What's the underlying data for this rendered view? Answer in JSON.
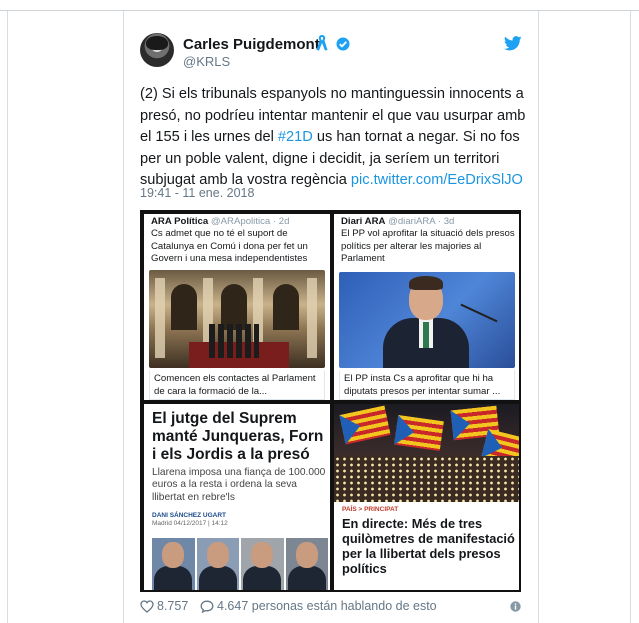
{
  "tweet": {
    "display_name": "Carles Puigdemont",
    "handle": "@KRLS",
    "text_before_hashtag": "(2) Si els tribunals espanyols no mantinguessin innocents a presó, no podríeu intentar mantenir el que  vau usurpar amb el 155 i les urnes del ",
    "hashtag": "#21D",
    "text_after_hashtag": " us han tornat a negar. Si no fos per un poble valent, digne i decidit, ja seríem un territori subjugat amb la vostra regència ",
    "pic_link": "pic.twitter.com/EeDrixSlJO",
    "timestamp": "19:41 - 11 ene. 2018"
  },
  "media": {
    "tile_a": {
      "account_name": "ARA Política",
      "account_handle": "@ARApolitica · 2d",
      "text": "Cs admet que no té el suport de Catalunya en Comú i dona per fet un Govern i una mesa independentistes",
      "caption": "Comencen els contactes al Parlament de cara la formació de la..."
    },
    "tile_b": {
      "account_name": "Diari ARA",
      "account_handle": "@diariARA · 3d",
      "text": "El PP vol aprofitar la situació dels presos polítics per alterar les majories al Parlament",
      "caption": "El PP insta Cs a aprofitar que hi ha diputats presos per intentar sumar ..."
    },
    "tile_c": {
      "headline": "El jutge del Suprem manté Junqueras, Forn i els Jordis a la presó",
      "lead": "Llarena imposa una fiança de 100.000 euros a la resta i ordena la seva llibertat en rebre'ls",
      "byline": "DANI SÁNCHEZ UGART",
      "date": "Madrid 04/12/2017 | 14:12"
    },
    "tile_d": {
      "kicker": "PAÍS > PRINCIPAT",
      "headline": "En directe: Més de tres quilòmetres de manifestació per la llibertat dels presos polítics"
    }
  },
  "footer": {
    "likes": "8.757",
    "talking": "4.647 personas están hablando de esto"
  },
  "icons": {
    "ribbon": "yellow-ribbon-icon",
    "verified": "verified-badge-icon",
    "bird": "twitter-bird-icon",
    "heart": "heart-icon",
    "bubble": "speech-bubble-icon",
    "info": "info-icon"
  },
  "colors": {
    "link": "#1b95e0",
    "secondary_text": "#657786",
    "ribbon": "#1da1f2"
  }
}
